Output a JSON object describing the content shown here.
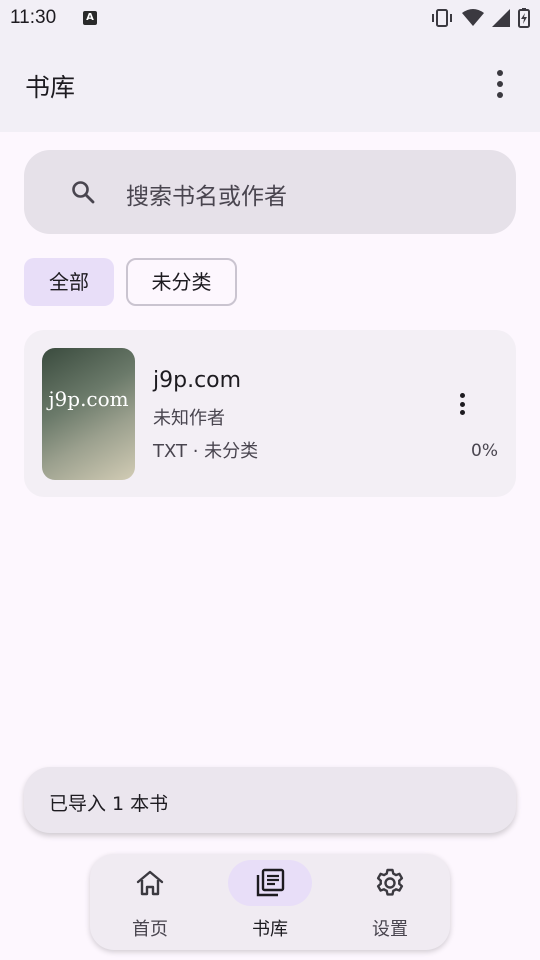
{
  "status_bar": {
    "time": "11:30",
    "icons": [
      "keyboard-a-icon",
      "vibrate-icon",
      "wifi-icon",
      "signal-icon",
      "battery-charging-icon"
    ]
  },
  "app_bar": {
    "title": "书库",
    "menu_icon": "more-vert-icon"
  },
  "search": {
    "placeholder": "搜索书名或作者",
    "icon": "search-icon"
  },
  "filters": [
    {
      "label": "全部",
      "selected": true
    },
    {
      "label": "未分类",
      "selected": false
    }
  ],
  "books": [
    {
      "cover_text": "j9p.com",
      "title": "j9p.com",
      "author": "未知作者",
      "meta": "TXT · 未分类",
      "progress": "0%"
    }
  ],
  "snackbar": {
    "message": "已导入 1 本书"
  },
  "bottom_nav": [
    {
      "label": "首页",
      "icon": "home-icon",
      "active": false
    },
    {
      "label": "书库",
      "icon": "library-icon",
      "active": true
    },
    {
      "label": "设置",
      "icon": "gear-icon",
      "active": false
    }
  ],
  "colors": {
    "background": "#fdf7fe",
    "app_bar": "#f2eff6",
    "selected_chip": "#e8def8",
    "search_bg": "#e6e1e9",
    "card_bg": "#f3eff5"
  }
}
